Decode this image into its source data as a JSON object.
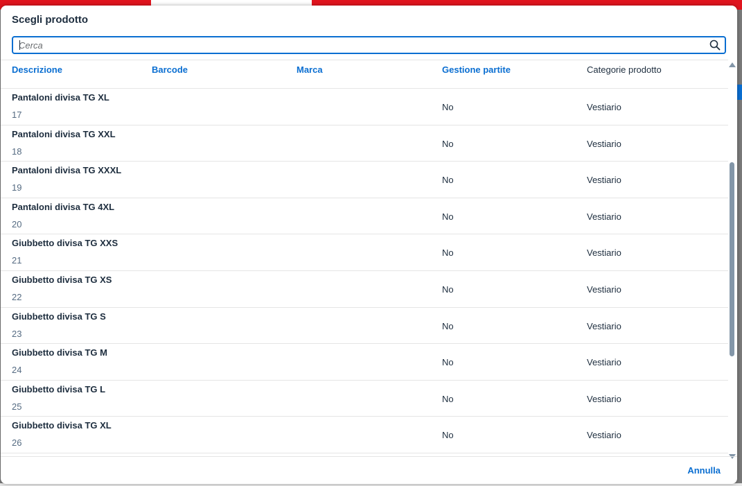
{
  "dialog": {
    "title": "Scegli prodotto",
    "search_placeholder": "Cerca",
    "cancel_label": "Annulla"
  },
  "table": {
    "columns": [
      {
        "label": "Descrizione"
      },
      {
        "label": "Barcode"
      },
      {
        "label": "Marca"
      },
      {
        "label": "Gestione partite"
      },
      {
        "label": "Categorie prodotto"
      }
    ],
    "rows": [
      {
        "name": "Pantaloni divisa TG XL",
        "code": "17",
        "gestione": "No",
        "categoria": "Vestiario"
      },
      {
        "name": "Pantaloni divisa TG XXL",
        "code": "18",
        "gestione": "No",
        "categoria": "Vestiario"
      },
      {
        "name": "Pantaloni divisa TG XXXL",
        "code": "19",
        "gestione": "No",
        "categoria": "Vestiario"
      },
      {
        "name": "Pantaloni divisa TG 4XL",
        "code": "20",
        "gestione": "No",
        "categoria": "Vestiario"
      },
      {
        "name": "Giubbetto divisa TG XXS",
        "code": "21",
        "gestione": "No",
        "categoria": "Vestiario"
      },
      {
        "name": "Giubbetto divisa TG XS",
        "code": "22",
        "gestione": "No",
        "categoria": "Vestiario"
      },
      {
        "name": "Giubbetto divisa TG S",
        "code": "23",
        "gestione": "No",
        "categoria": "Vestiario"
      },
      {
        "name": "Giubbetto divisa TG M",
        "code": "24",
        "gestione": "No",
        "categoria": "Vestiario"
      },
      {
        "name": "Giubbetto divisa TG L",
        "code": "25",
        "gestione": "No",
        "categoria": "Vestiario"
      },
      {
        "name": "Giubbetto divisa TG XL",
        "code": "26",
        "gestione": "No",
        "categoria": "Vestiario"
      }
    ]
  },
  "colors": {
    "accent": "#0a6ed1",
    "text": "#1d2d3e",
    "muted": "#556b82"
  },
  "icons": {
    "search": "search-icon",
    "scroll_up": "chevron-up-icon",
    "scroll_down": "chevron-down-icon"
  }
}
